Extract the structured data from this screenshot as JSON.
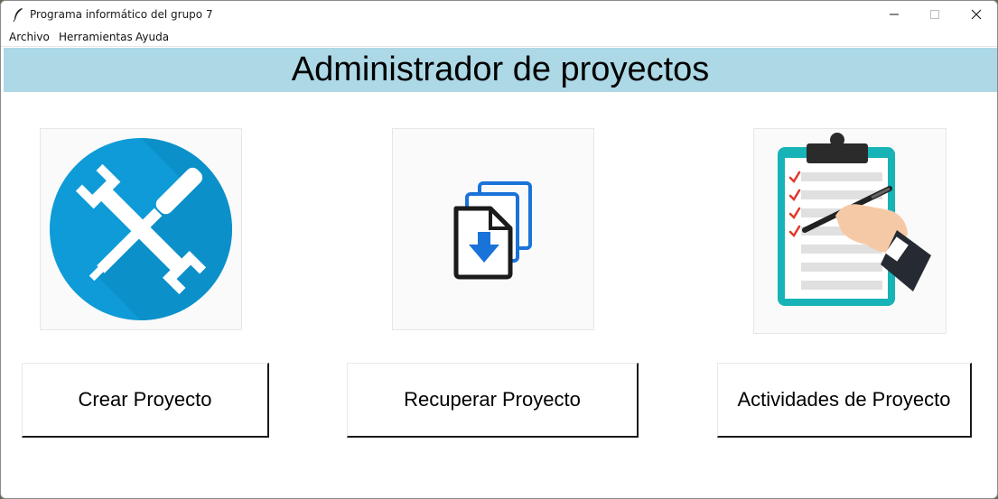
{
  "window": {
    "title": "Programa informático del grupo 7"
  },
  "menubar": {
    "items": [
      "Archivo",
      "Herramientas",
      "Ayuda"
    ]
  },
  "header": {
    "title": "Administrador de proyectos",
    "background": "#add8e6"
  },
  "cards": [
    {
      "icon": "tools-icon",
      "button_label": "Crear Proyecto"
    },
    {
      "icon": "documents-download-icon",
      "button_label": "Recuperar Proyecto"
    },
    {
      "icon": "clipboard-checklist-icon",
      "button_label": "Actividades de Proyecto"
    }
  ],
  "colors": {
    "tools_circle": "#0e9bd8",
    "doc_blue": "#1a73d9",
    "clipboard_teal": "#17b3b7",
    "check_red": "#e0392b"
  }
}
